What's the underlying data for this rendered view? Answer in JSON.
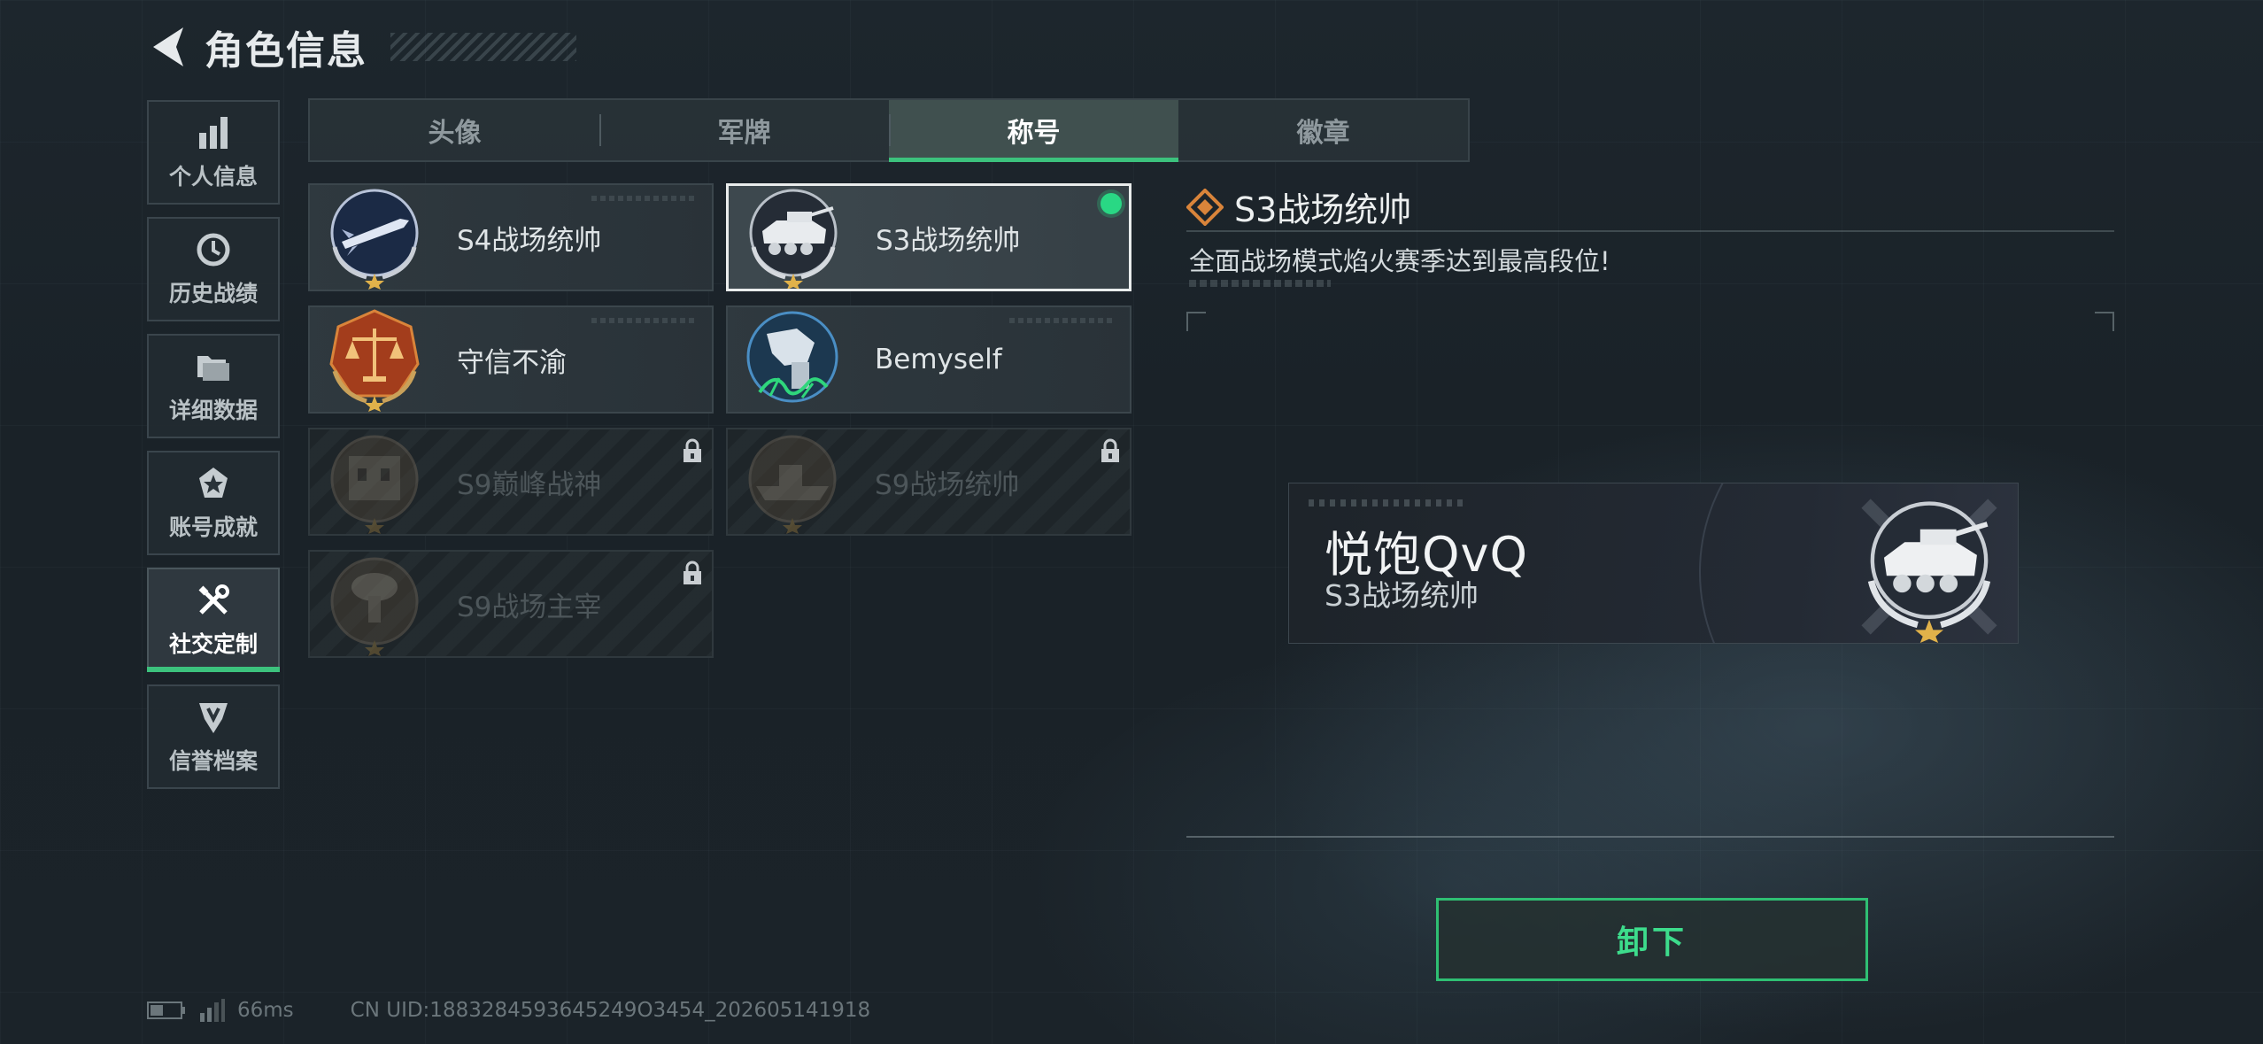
{
  "header": {
    "title": "角色信息"
  },
  "sidebar": {
    "items": [
      {
        "label": "个人信息",
        "icon": "bar-chart-icon"
      },
      {
        "label": "历史战绩",
        "icon": "clock-icon"
      },
      {
        "label": "详细数据",
        "icon": "folder-icon"
      },
      {
        "label": "账号成就",
        "icon": "achievement-badge-icon"
      },
      {
        "label": "社交定制",
        "icon": "wrench-icon",
        "active": true
      },
      {
        "label": "信誉档案",
        "icon": "credit-shield-icon"
      }
    ]
  },
  "tabs": [
    {
      "label": "头像"
    },
    {
      "label": "军牌"
    },
    {
      "label": "称号",
      "active": true
    },
    {
      "label": "徽章"
    }
  ],
  "titles": [
    {
      "label": "S4战场统帅",
      "emblem": "missile-emblem-icon",
      "state": "unlocked"
    },
    {
      "label": "S3战场统帅",
      "emblem": "tank-emblem-icon",
      "state": "equipped"
    },
    {
      "label": "守信不渝",
      "emblem": "scales-emblem-icon",
      "state": "unlocked"
    },
    {
      "label": "Bemyself",
      "emblem": "mech-emblem-icon",
      "state": "unlocked"
    },
    {
      "label": "S9巅峰战神",
      "emblem": "fortress-emblem-icon",
      "state": "locked"
    },
    {
      "label": "S9战场统帅",
      "emblem": "warship-emblem-icon",
      "state": "locked"
    },
    {
      "label": "S9战场主宰",
      "emblem": "explosion-emblem-icon",
      "state": "locked"
    }
  ],
  "detail": {
    "title": "S3战场统帅",
    "description": "全面战场模式焰火赛季达到最高段位!"
  },
  "preview": {
    "player_name": "悦饱QvQ",
    "title": "S3战场统帅"
  },
  "action": {
    "label": "卸下"
  },
  "status": {
    "ping": "66ms",
    "uid": "CN UID:1883284593645249O3454_202605141918"
  },
  "colors": {
    "accent": "#3cc27d",
    "equipped_dot": "#29d884",
    "title_icon": "#d9843a"
  }
}
